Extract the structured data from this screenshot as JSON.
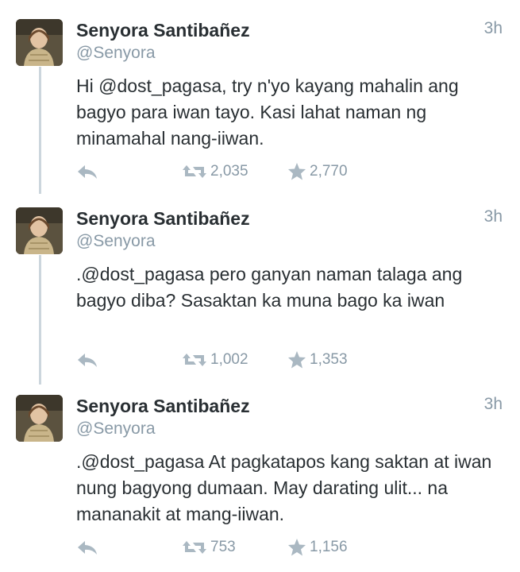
{
  "tweets": [
    {
      "name": "Senyora Santibañez",
      "handle": "@Senyora",
      "time": "3h",
      "text": "Hi @dost_pagasa, try n'yo kayang mahalin ang bagyo para iwan tayo. Kasi lahat naman ng minamahal nang-iiwan.",
      "retweets": "2,035",
      "favorites": "2,770"
    },
    {
      "name": "Senyora Santibañez",
      "handle": "@Senyora",
      "time": "3h",
      "text": ".@dost_pagasa pero ganyan naman talaga ang bagyo diba? Sasaktan ka muna bago ka iwan",
      "retweets": "1,002",
      "favorites": "1,353"
    },
    {
      "name": "Senyora Santibañez",
      "handle": "@Senyora",
      "time": "3h",
      "text": ".@dost_pagasa At pagkatapos kang saktan at iwan nung bagyong dumaan. May darating ulit... na mananakit at mang-iiwan.",
      "retweets": "753",
      "favorites": "1,156"
    }
  ],
  "icons": {
    "reply": "reply-icon",
    "retweet": "retweet-icon",
    "favorite": "star-icon"
  },
  "colors": {
    "icon_gray": "#aab8c2",
    "meta_gray": "#8899a6",
    "thread_line": "#ccd6dd"
  }
}
